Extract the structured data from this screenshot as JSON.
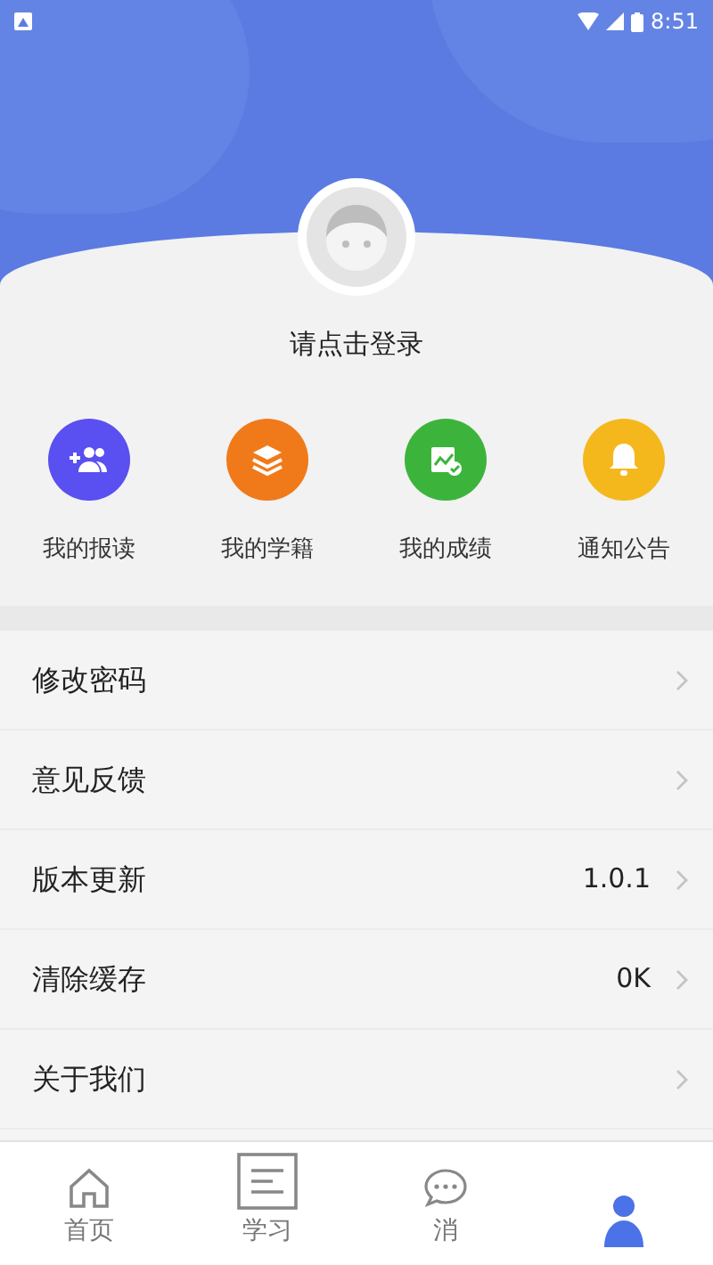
{
  "status_bar": {
    "time": "8:51"
  },
  "profile": {
    "login_prompt": "请点击登录"
  },
  "shortcuts": [
    {
      "label": "我的报读",
      "color": "#5a4ff0"
    },
    {
      "label": "我的学籍",
      "color": "#f07a1a"
    },
    {
      "label": "我的成绩",
      "color": "#3cb43c"
    },
    {
      "label": "通知公告",
      "color": "#f5b81c"
    }
  ],
  "settings": [
    {
      "label": "修改密码"
    },
    {
      "label": "意见反馈"
    },
    {
      "label": "版本更新",
      "value": "1.0.1"
    },
    {
      "label": "清除缓存",
      "value": "0K"
    },
    {
      "label": "关于我们"
    }
  ],
  "bottom_nav": [
    {
      "label": "首页",
      "selected": false
    },
    {
      "label": "学习",
      "selected": false
    },
    {
      "label": "消",
      "selected": false
    },
    {
      "selected": true
    }
  ]
}
